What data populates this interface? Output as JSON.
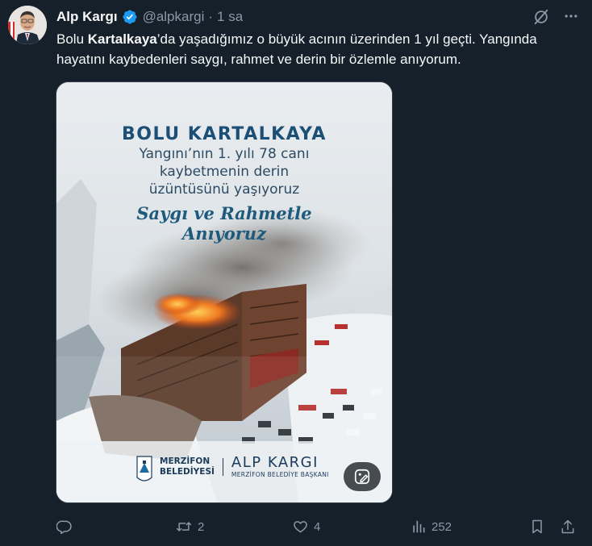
{
  "tweet": {
    "author_name": "Alp Kargı",
    "handle": "@alpkargi",
    "separator": "·",
    "time": "1 sa",
    "text_before": "Bolu ",
    "text_bold": "Kartalkaya",
    "text_after": "’da yaşadığımız o büyük acının üzerinden 1 yıl geçti. Yangında hayatını kaybedenleri saygı, rahmet ve derin bir özlemle anıyorum."
  },
  "image": {
    "title": "BOLU KARTALKAYA",
    "line1": "Yangını’nın 1. yılı 78 canı",
    "line2": "kaybetmenin derin",
    "line3": "üzüntüsünü yaşıyoruz",
    "script1": "Saygı ve Rahmetle",
    "script2": "Anıyoruz",
    "logo_line1": "MERZİFON",
    "logo_line2": "BELEDİYESİ",
    "mayor_name": "ALP KARGI",
    "mayor_title": "MERZİFON BELEDİYE BAŞKANI"
  },
  "actions": {
    "reply_count": "",
    "retweet_count": "2",
    "like_count": "4",
    "views_count": "252"
  },
  "icons": {
    "verified": "verified-badge-icon",
    "grok": "grok-icon",
    "more": "more-icon",
    "reply": "reply-icon",
    "retweet": "retweet-icon",
    "like": "heart-icon",
    "views": "views-icon",
    "bookmark": "bookmark-icon",
    "share": "share-icon"
  },
  "colors": {
    "background": "#15202b",
    "text": "#f7f9f9",
    "muted": "#8b98a5",
    "verified": "#1d9bf0"
  }
}
